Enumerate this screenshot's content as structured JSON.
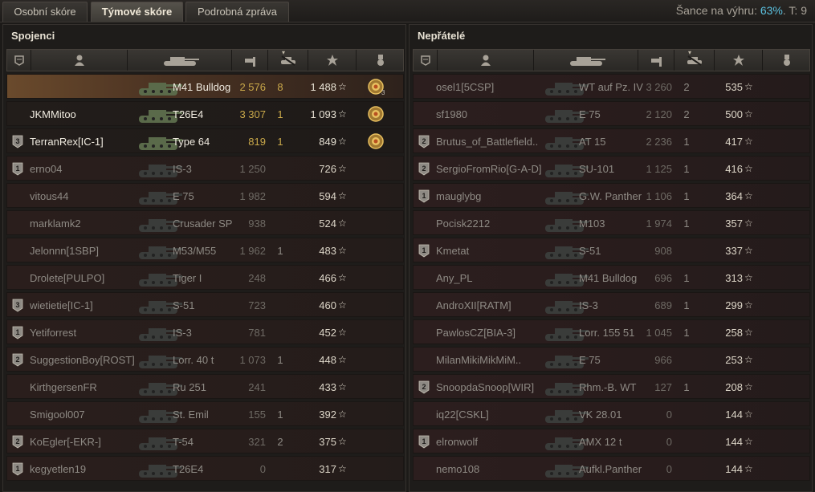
{
  "tabs": [
    {
      "label": "Osobní skóre",
      "active": false
    },
    {
      "label": "Týmové skóre",
      "active": true
    },
    {
      "label": "Podrobná zpráva",
      "active": false
    }
  ],
  "win_chance": {
    "label": "Šance na výhru:",
    "value": "63%",
    "tier_label": "T: 9"
  },
  "header_icons": [
    "platoon-icon",
    "player-icon",
    "tank-icon",
    "damage-icon",
    "kills-icon",
    "xp-icon",
    "medal-icon"
  ],
  "allies": {
    "title": "Spojenci",
    "rows": [
      {
        "badge": "",
        "player": "",
        "tank": "M41 Bulldog",
        "damage": "2 576",
        "kills": "8",
        "xp": "1 488",
        "medal": "3",
        "style": "self"
      },
      {
        "badge": "",
        "player": "JKMMitoo",
        "tank": "T26E4",
        "damage": "3 307",
        "kills": "1",
        "xp": "1 093",
        "medal": "1",
        "style": "bright"
      },
      {
        "badge": "3",
        "player": "TerranRex[IC-1]",
        "tank": "Type 64",
        "damage": "819",
        "kills": "1",
        "xp": "849",
        "medal": "1",
        "style": "bright"
      },
      {
        "badge": "1",
        "player": "erno04",
        "tank": "IS-3",
        "damage": "1 250",
        "kills": "",
        "xp": "726",
        "medal": "",
        "style": "dead"
      },
      {
        "badge": "",
        "player": "vitous44",
        "tank": "E 75",
        "damage": "1 982",
        "kills": "",
        "xp": "594",
        "medal": "",
        "style": "dead"
      },
      {
        "badge": "",
        "player": "marklamk2",
        "tank": "Crusader SP",
        "damage": "938",
        "kills": "",
        "xp": "524",
        "medal": "",
        "style": "dead"
      },
      {
        "badge": "",
        "player": "Jelonnn[1SBP]",
        "tank": "M53/M55",
        "damage": "1 962",
        "kills": "1",
        "xp": "483",
        "medal": "",
        "style": "dead"
      },
      {
        "badge": "",
        "player": "Drolete[PULPO]",
        "tank": "Tiger I",
        "damage": "248",
        "kills": "",
        "xp": "466",
        "medal": "",
        "style": "dead"
      },
      {
        "badge": "3",
        "player": "wietietie[IC-1]",
        "tank": "S-51",
        "damage": "723",
        "kills": "",
        "xp": "460",
        "medal": "",
        "style": "dead"
      },
      {
        "badge": "1",
        "player": "Yetiforrest",
        "tank": "IS-3",
        "damage": "781",
        "kills": "",
        "xp": "452",
        "medal": "",
        "style": "dead"
      },
      {
        "badge": "2",
        "player": "SuggestionBoy[ROST]",
        "tank": "Lorr. 40 t",
        "damage": "1 073",
        "kills": "1",
        "xp": "448",
        "medal": "",
        "style": "dead"
      },
      {
        "badge": "",
        "player": "KirthgersenFR",
        "tank": "Ru 251",
        "damage": "241",
        "kills": "",
        "xp": "433",
        "medal": "",
        "style": "dead"
      },
      {
        "badge": "",
        "player": "Smigool007",
        "tank": "St. Emil",
        "damage": "155",
        "kills": "1",
        "xp": "392",
        "medal": "",
        "style": "dead"
      },
      {
        "badge": "2",
        "player": "KoEgler[-EKR-]",
        "tank": "T-54",
        "damage": "321",
        "kills": "2",
        "xp": "375",
        "medal": "",
        "style": "dead"
      },
      {
        "badge": "1",
        "player": "kegyetlen19",
        "tank": "T26E4",
        "damage": "0",
        "kills": "",
        "xp": "317",
        "medal": "",
        "style": "dead"
      }
    ]
  },
  "enemies": {
    "title": "Nepřátelé",
    "rows": [
      {
        "badge": "",
        "player": "osel1[5CSP]",
        "tank": "WT auf Pz. IV",
        "damage": "3 260",
        "kills": "2",
        "xp": "535"
      },
      {
        "badge": "",
        "player": "sf1980",
        "tank": "E 75",
        "damage": "2 120",
        "kills": "2",
        "xp": "500"
      },
      {
        "badge": "2",
        "player": "Brutus_of_Battlefield..",
        "tank": "AT 15",
        "damage": "2 236",
        "kills": "1",
        "xp": "417"
      },
      {
        "badge": "2",
        "player": "SergioFromRio[G-A-D]",
        "tank": "SU-101",
        "damage": "1 125",
        "kills": "1",
        "xp": "416"
      },
      {
        "badge": "1",
        "player": "mauglybg",
        "tank": "G.W. Panther",
        "damage": "1 106",
        "kills": "1",
        "xp": "364"
      },
      {
        "badge": "",
        "player": "Pocisk2212",
        "tank": "M103",
        "damage": "1 974",
        "kills": "1",
        "xp": "357"
      },
      {
        "badge": "1",
        "player": "Kmetat",
        "tank": "S-51",
        "damage": "908",
        "kills": "",
        "xp": "337"
      },
      {
        "badge": "",
        "player": "Any_PL",
        "tank": "M41 Bulldog",
        "damage": "696",
        "kills": "1",
        "xp": "313"
      },
      {
        "badge": "",
        "player": "AndroXII[RATM]",
        "tank": "IS-3",
        "damage": "689",
        "kills": "1",
        "xp": "299"
      },
      {
        "badge": "",
        "player": "PawlosCZ[BIA-3]",
        "tank": "Lorr. 155 51",
        "damage": "1 045",
        "kills": "1",
        "xp": "258"
      },
      {
        "badge": "",
        "player": "MilanMikiMikMiM..",
        "tank": "E 75",
        "damage": "966",
        "kills": "",
        "xp": "253"
      },
      {
        "badge": "2",
        "player": "SnoopdaSnoop[WIR]",
        "tank": "Rhm.-B. WT",
        "damage": "127",
        "kills": "1",
        "xp": "208"
      },
      {
        "badge": "",
        "player": "iq22[CSKL]",
        "tank": "VK 28.01",
        "damage": "0",
        "kills": "",
        "xp": "144"
      },
      {
        "badge": "1",
        "player": "elronwolf",
        "tank": "AMX 12 t",
        "damage": "0",
        "kills": "",
        "xp": "144"
      },
      {
        "badge": "",
        "player": "nemo108",
        "tank": "Aufkl.Panther",
        "damage": "0",
        "kills": "",
        "xp": "144"
      }
    ]
  },
  "star_glyph": "☆"
}
